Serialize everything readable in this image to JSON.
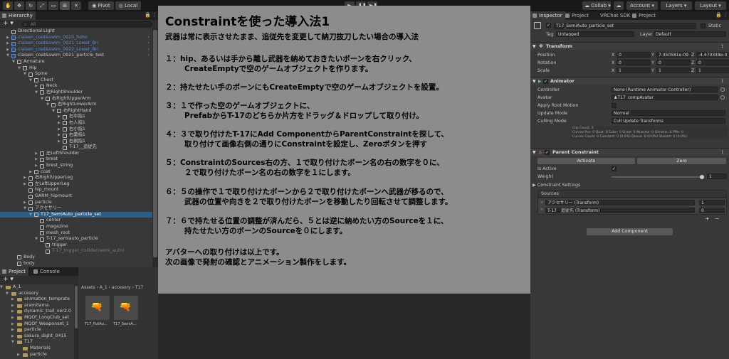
{
  "toolbar": {
    "pivot": "Pivot",
    "local": "Local",
    "collab": "Collab",
    "account": "Account",
    "layers": "Layers",
    "layout": "Layout"
  },
  "hierarchy": {
    "tab": "Hierarchy",
    "plus": "+",
    "search_placeholder": "All",
    "rows": [
      {
        "label": "Directional Light",
        "indent": 2,
        "arrow": "",
        "cube": "white",
        "style": ""
      },
      {
        "label": "claisen_coat&swim_0920_hoho",
        "indent": 2,
        "arrow": "▶",
        "cube": "blue",
        "style": "blue"
      },
      {
        "label": "claisen_coat&swim_0921_Lower_Bri",
        "indent": 2,
        "arrow": "▶",
        "cube": "blue",
        "style": "blue"
      },
      {
        "label": "claisen_coat&swim_0922_Lower_Bri",
        "indent": 2,
        "arrow": "▶",
        "cube": "blue",
        "style": "blue"
      },
      {
        "label": "claisen_coat&swim_0921_particle_test",
        "indent": 2,
        "arrow": "▼",
        "cube": "blue",
        "style": ""
      },
      {
        "label": "Armature",
        "indent": 3,
        "arrow": "▼",
        "cube": "white",
        "style": ""
      },
      {
        "label": "Hip",
        "indent": 4,
        "arrow": "▼",
        "cube": "white",
        "style": ""
      },
      {
        "label": "Spine",
        "indent": 5,
        "arrow": "▼",
        "cube": "white",
        "style": ""
      },
      {
        "label": "Chest",
        "indent": 6,
        "arrow": "▼",
        "cube": "white",
        "style": ""
      },
      {
        "label": "Neck",
        "indent": 7,
        "arrow": "▶",
        "cube": "white",
        "style": ""
      },
      {
        "label": "右RightShoulder",
        "indent": 7,
        "arrow": "▼",
        "cube": "white",
        "style": ""
      },
      {
        "label": "右RightUpperArm",
        "indent": 8,
        "arrow": "▼",
        "cube": "white",
        "style": ""
      },
      {
        "label": "右RightLowerArm",
        "indent": 9,
        "arrow": "▼",
        "cube": "white",
        "style": ""
      },
      {
        "label": "右RightHand",
        "indent": 10,
        "arrow": "▼",
        "cube": "white",
        "style": ""
      },
      {
        "label": "右中指1",
        "indent": 11,
        "arrow": "▶",
        "cube": "white",
        "style": ""
      },
      {
        "label": "右人指1",
        "indent": 11,
        "arrow": "▶",
        "cube": "white",
        "style": ""
      },
      {
        "label": "右小指1",
        "indent": 11,
        "arrow": "▶",
        "cube": "white",
        "style": ""
      },
      {
        "label": "右薬指1",
        "indent": 11,
        "arrow": "▶",
        "cube": "white",
        "style": ""
      },
      {
        "label": "右親指1",
        "indent": 11,
        "arrow": "▶",
        "cube": "white",
        "style": ""
      },
      {
        "label": "T-17__追従先",
        "indent": 11,
        "arrow": "",
        "cube": "white",
        "style": ""
      },
      {
        "label": "左LeftShoulder",
        "indent": 7,
        "arrow": "▶",
        "cube": "white",
        "style": ""
      },
      {
        "label": "brest",
        "indent": 7,
        "arrow": "▶",
        "cube": "white",
        "style": ""
      },
      {
        "label": "brest_string",
        "indent": 7,
        "arrow": "▶",
        "cube": "white",
        "style": ""
      },
      {
        "label": "coat",
        "indent": 6,
        "arrow": "▶",
        "cube": "white",
        "style": ""
      },
      {
        "label": "右RightUpperLeg",
        "indent": 5,
        "arrow": "▶",
        "cube": "white",
        "style": ""
      },
      {
        "label": "左LeftUpperLeg",
        "indent": 5,
        "arrow": "▶",
        "cube": "white",
        "style": ""
      },
      {
        "label": "hip_mount",
        "indent": 5,
        "arrow": "",
        "cube": "white",
        "style": ""
      },
      {
        "label": "GARM_hipmount",
        "indent": 5,
        "arrow": "",
        "cube": "white",
        "style": ""
      },
      {
        "label": "particle",
        "indent": 5,
        "arrow": "▶",
        "cube": "white",
        "style": ""
      },
      {
        "label": "アクセサリー",
        "indent": 5,
        "arrow": "▼",
        "cube": "white",
        "style": ""
      },
      {
        "label": "T17_SemiAuto_particle_set",
        "indent": 6,
        "arrow": "▼",
        "cube": "white",
        "style": "sel"
      },
      {
        "label": "center",
        "indent": 7,
        "arrow": "",
        "cube": "white",
        "style": ""
      },
      {
        "label": "magazine",
        "indent": 7,
        "arrow": "",
        "cube": "white",
        "style": ""
      },
      {
        "label": "mesh_root",
        "indent": 7,
        "arrow": "",
        "cube": "white",
        "style": ""
      },
      {
        "label": "T-17_semiauto_particle",
        "indent": 7,
        "arrow": "▼",
        "cube": "white",
        "style": ""
      },
      {
        "label": "trigger",
        "indent": 8,
        "arrow": "",
        "cube": "white",
        "style": ""
      },
      {
        "label": "T-17_trigger_collider(semi_auto)",
        "indent": 8,
        "arrow": "",
        "cube": "white",
        "style": "dim"
      },
      {
        "label": "Body",
        "indent": 3,
        "arrow": "",
        "cube": "white",
        "style": ""
      },
      {
        "label": "body",
        "indent": 3,
        "arrow": "",
        "cube": "white",
        "style": ""
      }
    ]
  },
  "project": {
    "tab_project": "Project",
    "tab_console": "Console",
    "plus": "+",
    "folders": [
      {
        "label": "A_1",
        "indent": 1,
        "arrow": "▼"
      },
      {
        "label": "accesory",
        "indent": 2,
        "arrow": "▼"
      },
      {
        "label": "animation_temprate",
        "indent": 3,
        "arrow": "▶"
      },
      {
        "label": "aramitama",
        "indent": 3,
        "arrow": "▶"
      },
      {
        "label": "dynamic_trail_ver2.0",
        "indent": 3,
        "arrow": "▶"
      },
      {
        "label": "MQOf_LongClub_set",
        "indent": 3,
        "arrow": "▶"
      },
      {
        "label": "MQOf_Weaponset_1",
        "indent": 3,
        "arrow": "▶"
      },
      {
        "label": "particle",
        "indent": 3,
        "arrow": "▶"
      },
      {
        "label": "sakura_dight_0415",
        "indent": 3,
        "arrow": "▶"
      },
      {
        "label": "T17",
        "indent": 3,
        "arrow": "▼"
      },
      {
        "label": "Materials",
        "indent": 4,
        "arrow": ""
      },
      {
        "label": "particle",
        "indent": 4,
        "arrow": "▶"
      }
    ],
    "breadcrumb": [
      "Assets",
      "A_1",
      "accesory",
      "T17"
    ],
    "assets": [
      {
        "label": "T17_FullAu..."
      },
      {
        "label": "T17_SemiA..."
      }
    ]
  },
  "overlay": {
    "title": "Constraintを使った導入法1",
    "subtitle": "武器は常に表示させたまま、追従先を変更して納刀抜刀したい場合の導入法",
    "lines": [
      {
        "text": "１：hip、あるいは手から離し武器を納めておきたいボーンを右クリック、",
        "indent": false
      },
      {
        "text": "CreateEmptyで空のゲームオブジェクトを作ります。",
        "indent": true
      },
      {
        "text": "２：持たせたい手のボーンにもCreateEmptyで空のゲームオブジェクトを設置。",
        "indent": false
      },
      {
        "text": "３：１で作った空のゲームオブジェクトに、",
        "indent": false
      },
      {
        "text": "PrefabからT-17のどちらか片方をドラッグ＆ドロップして取り付け。",
        "indent": true
      },
      {
        "text": "４：３で取り付けたT-17にAdd ComponentからParentConstraintを探して、",
        "indent": false
      },
      {
        "text": "取り付けて画像右側の通りにConstraintを設定し、Zeroボタンを押す",
        "indent": true
      },
      {
        "text": "５：ConstraintのSources右の方、１で取り付けたボーン名の右の数字を０に、",
        "indent": false
      },
      {
        "text": "２で取り付けたボーン名の右の数字を１にします。",
        "indent": true
      },
      {
        "text": "６：５の操作で１で取り付けたボーンから２で取り付けたボーンへ武器が移るので、",
        "indent": false
      },
      {
        "text": "武器の位置や向きを２で取り付けたボーンを移動したり回転させて調整します。",
        "indent": true
      },
      {
        "text": "７：６で持たせる位置の調整が済んだら、５とは逆に納めたい方のSourceを１に、",
        "indent": false
      },
      {
        "text": "持たせたい方のボーンのSourceを０にします。",
        "indent": true
      },
      {
        "text": "アバターへの取り付けは以上です。",
        "indent": false
      },
      {
        "text": "次の画像で発射の確認とアニメーション製作をします。",
        "indent": false
      }
    ]
  },
  "inspector": {
    "tabs": [
      "Inspector",
      "Project",
      "VRChat SDK",
      "Project"
    ],
    "object_name": "T17_SemiAuto_particle_set",
    "static_label": "Static",
    "tag_label": "Tag",
    "tag_value": "Untagged",
    "layer_label": "Layer",
    "layer_value": "Default",
    "transform": {
      "title": "Transform",
      "rows": [
        {
          "label": "Position",
          "x": "0",
          "y": "7.450581e-09",
          "z": "-4.470348e-0"
        },
        {
          "label": "Rotation",
          "x": "0",
          "y": "0",
          "z": "0"
        },
        {
          "label": "Scale",
          "x": "1",
          "y": "1",
          "z": "1"
        }
      ],
      "axis_x": "X",
      "axis_y": "Y",
      "axis_z": "Z"
    },
    "animator": {
      "title": "Animator",
      "controller_label": "Controller",
      "controller_value": "None (Runtime Animator Controller)",
      "avatar_label": "Avatar",
      "avatar_value": "T17_compAvatar",
      "root_motion_label": "Apply Root Motion",
      "update_mode_label": "Update Mode",
      "update_mode_value": "Normal",
      "culling_label": "Culling Mode",
      "culling_value": "Cull Update Transforms",
      "info1": "Clip Count: 0",
      "info2": "Curves Pos: 0 Quat: 0 Euler: 0 Scale: 0 Muscles: 0 Generic: 0 PPtr: 0",
      "info3": "Curves Count: 0 Constant: 0 (0.0%) Dense: 0 (0.0%) Stream: 0 (0.0%)"
    },
    "parent_constraint": {
      "title": "Parent Constraint",
      "activate": "Activate",
      "zero": "Zero",
      "is_active_label": "Is Active",
      "is_active_check": "✓",
      "weight_label": "Weight",
      "weight_value": "1",
      "weight_fraction": 1.0,
      "settings_label": "Constraint Settings",
      "sources_label": "Sources",
      "sources": [
        {
          "name": "アクセサリー (Transform)",
          "value": "1"
        },
        {
          "name": "T-17__追従先 (Transform)",
          "value": "0"
        }
      ],
      "add": "+",
      "remove": "−"
    },
    "add_component": "Add Component"
  }
}
